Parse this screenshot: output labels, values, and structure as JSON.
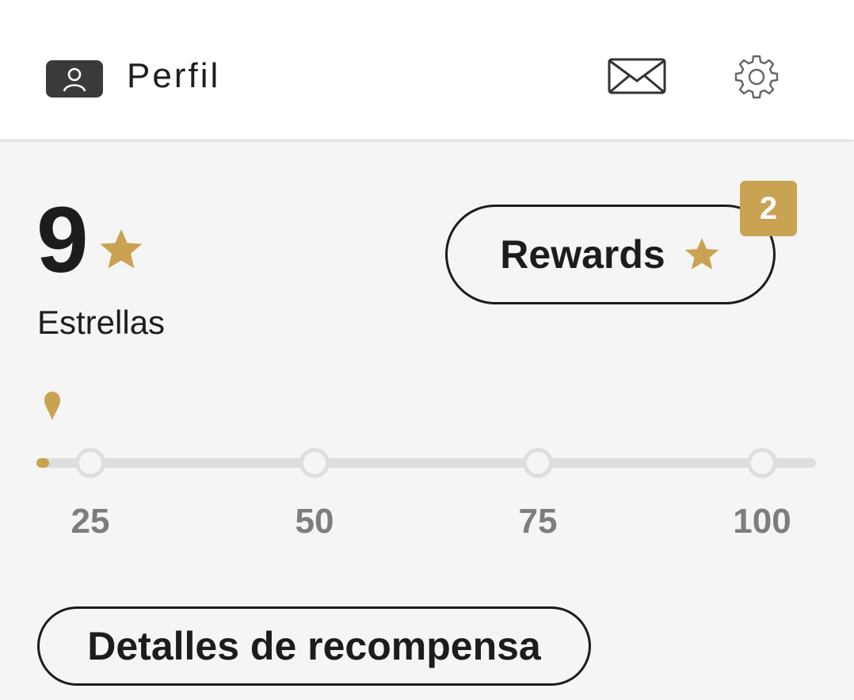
{
  "header": {
    "title": "Perfil",
    "profile_icon": "person-icon",
    "messages_icon": "envelope-icon",
    "settings_icon": "gear-icon"
  },
  "stars": {
    "count": "9",
    "label": "Estrellas",
    "icon": "star-icon"
  },
  "rewards": {
    "label": "Rewards",
    "icon": "star-icon",
    "badge_count": "2"
  },
  "progress": {
    "current": 9,
    "max": 100,
    "milestones": [
      {
        "value": 25,
        "label": "25"
      },
      {
        "value": 50,
        "label": "50"
      },
      {
        "value": 75,
        "label": "75"
      },
      {
        "value": 100,
        "label": "100"
      }
    ]
  },
  "details_button": {
    "label": "Detalles de recompensa"
  },
  "colors": {
    "accent_gold": "#c9a252",
    "text_dark": "#1c1c1c",
    "track_gray": "#dedede",
    "background": "#f5f5f5"
  }
}
